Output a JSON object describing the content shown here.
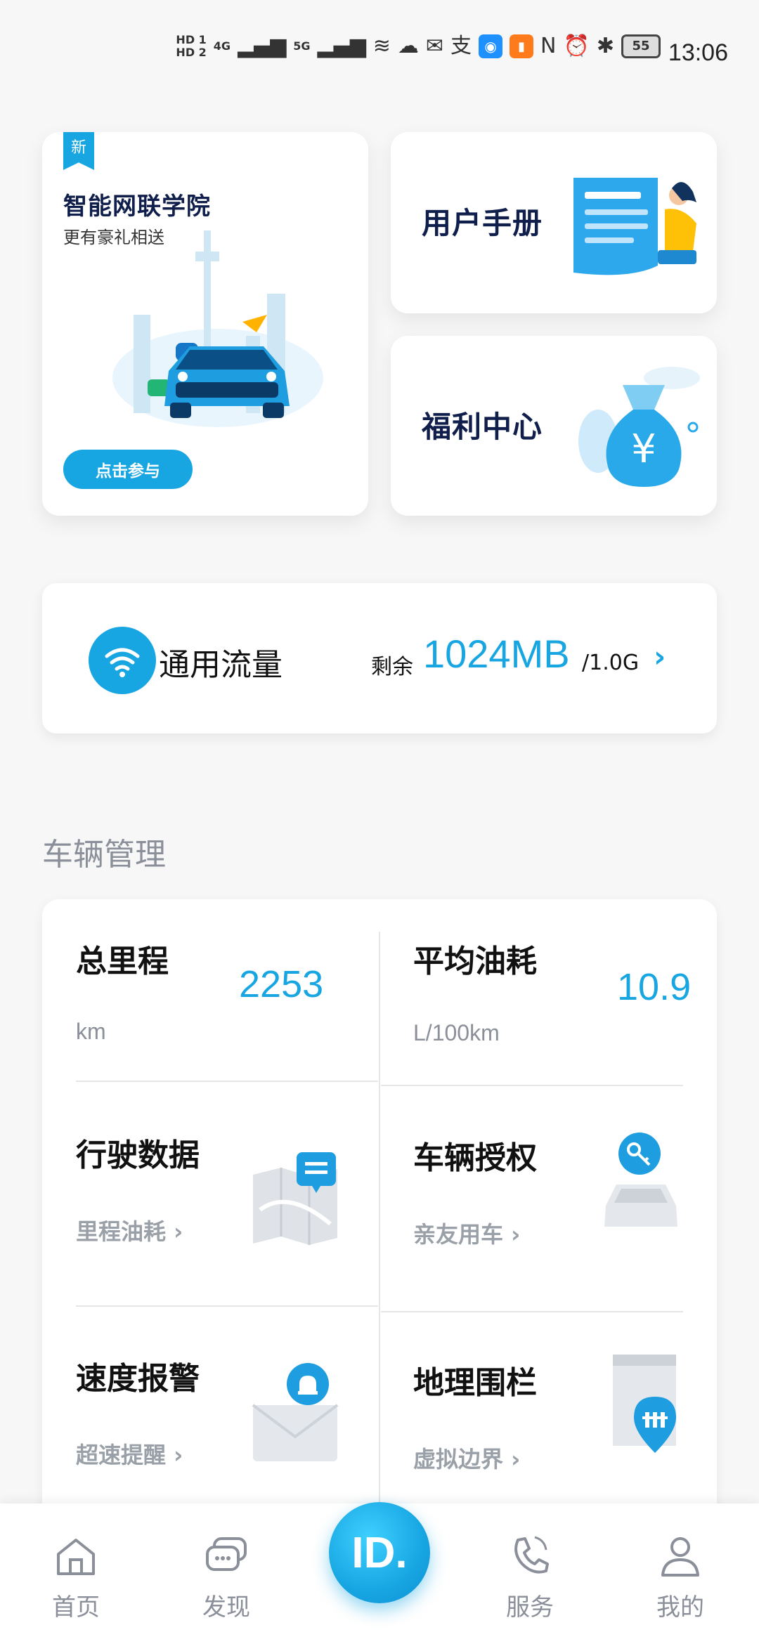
{
  "status_bar": {
    "hd1": "HD 1",
    "hd2": "HD 2",
    "net1": "4G",
    "net2": "5G",
    "battery": "55",
    "time": "13:06"
  },
  "promo": {
    "academy": {
      "tag": "新",
      "title": "智能网联学院",
      "subtitle": "更有豪礼相送",
      "button": "点击参与"
    },
    "manual": {
      "title": "用户手册"
    },
    "welfare": {
      "title": "福利中心"
    }
  },
  "data_card": {
    "title": "通用流量",
    "remain_label": "剩余",
    "remain_value": "1024MB",
    "total": "/1.0G"
  },
  "vehicle": {
    "section_title": "车辆管理",
    "mileage": {
      "label": "总里程",
      "value": "2253",
      "unit": "km"
    },
    "fuel": {
      "label": "平均油耗",
      "value": "10.9",
      "unit": "L/100km"
    },
    "tiles": [
      {
        "title": "行驶数据",
        "sub": "里程油耗"
      },
      {
        "title": "车辆授权",
        "sub": "亲友用车"
      },
      {
        "title": "速度报警",
        "sub": "超速提醒"
      },
      {
        "title": "地理围栏",
        "sub": "虚拟边界"
      }
    ]
  },
  "nav": {
    "items": [
      {
        "label": "首页",
        "icon": "home-icon"
      },
      {
        "label": "发现",
        "icon": "chat-icon"
      },
      {
        "label": "ID.",
        "icon": "id-logo"
      },
      {
        "label": "服务",
        "icon": "phone-icon"
      },
      {
        "label": "我的",
        "icon": "user-icon"
      }
    ]
  },
  "colors": {
    "accent": "#17a6e2",
    "title_dark": "#0f1e4a",
    "muted": "#8a8f99"
  }
}
